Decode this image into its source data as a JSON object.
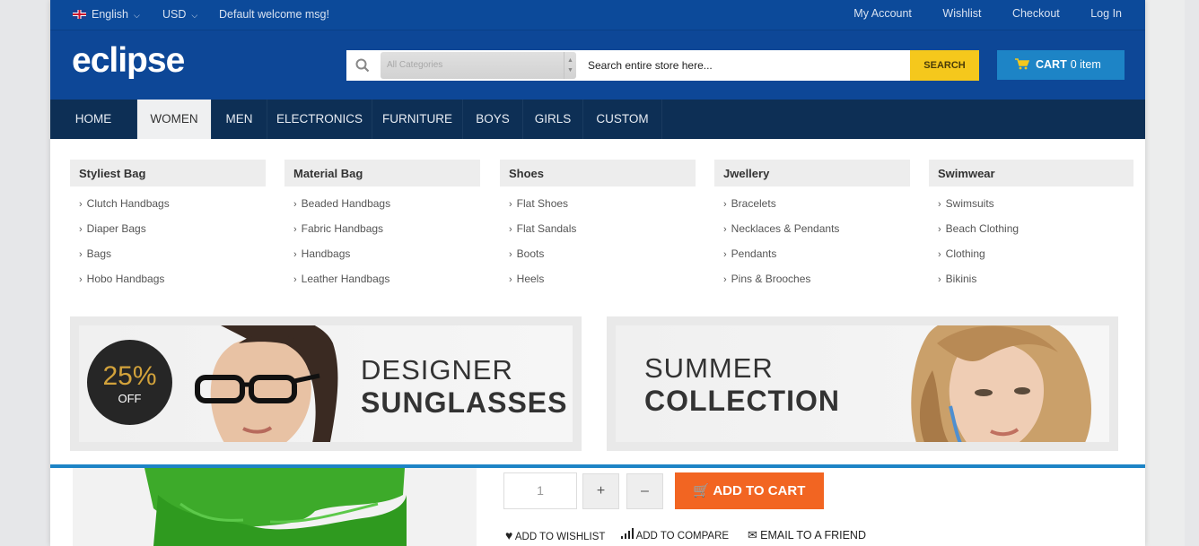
{
  "topbar": {
    "language": "English",
    "currency": "USD",
    "welcome": "Default welcome msg!",
    "links": [
      "My Account",
      "Wishlist",
      "Checkout",
      "Log In"
    ]
  },
  "header": {
    "logo": "eclipse",
    "category_placeholder": "All Categories",
    "search_placeholder": "Search entire store here...",
    "search_button": "SEARCH",
    "cart_label": "CART",
    "cart_count": "0 item"
  },
  "nav": [
    "HOME",
    "WOMEN",
    "MEN",
    "ELECTRONICS",
    "FURNITURE",
    "BOYS",
    "GIRLS",
    "CUSTOM"
  ],
  "mega": {
    "columns": [
      {
        "title": "Styliest Bag",
        "items": [
          "Clutch Handbags",
          "Diaper Bags",
          "Bags",
          "Hobo Handbags"
        ]
      },
      {
        "title": "Material Bag",
        "items": [
          "Beaded Handbags",
          "Fabric Handbags",
          "Handbags",
          "Leather Handbags"
        ]
      },
      {
        "title": "Shoes",
        "items": [
          "Flat Shoes",
          "Flat Sandals",
          "Boots",
          "Heels"
        ]
      },
      {
        "title": "Jwellery",
        "items": [
          "Bracelets",
          "Necklaces & Pendants",
          "Pendants",
          "Pins & Brooches"
        ]
      },
      {
        "title": "Swimwear",
        "items": [
          "Swimsuits",
          "Beach Clothing",
          "Clothing",
          "Bikinis"
        ]
      }
    ],
    "banner1": {
      "badge_pct": "25%",
      "badge_off": "OFF",
      "line1": "DESIGNER",
      "line2": "SUNGLASSES"
    },
    "banner2": {
      "line1": "SUMMER",
      "line2": "COLLECTION"
    }
  },
  "product": {
    "qty": "1",
    "plus": "+",
    "minus": "–",
    "add_to_cart": "ADD TO CART",
    "actions": [
      "ADD TO WISHLIST",
      "ADD TO COMPARE",
      "EMAIL TO A FRIEND"
    ]
  },
  "colors": {
    "topbar": "#0c4a9a",
    "nav": "#0d2f55",
    "search_button": "#f5c81c",
    "cart": "#1d84c6",
    "add_to_cart": "#f26522"
  }
}
